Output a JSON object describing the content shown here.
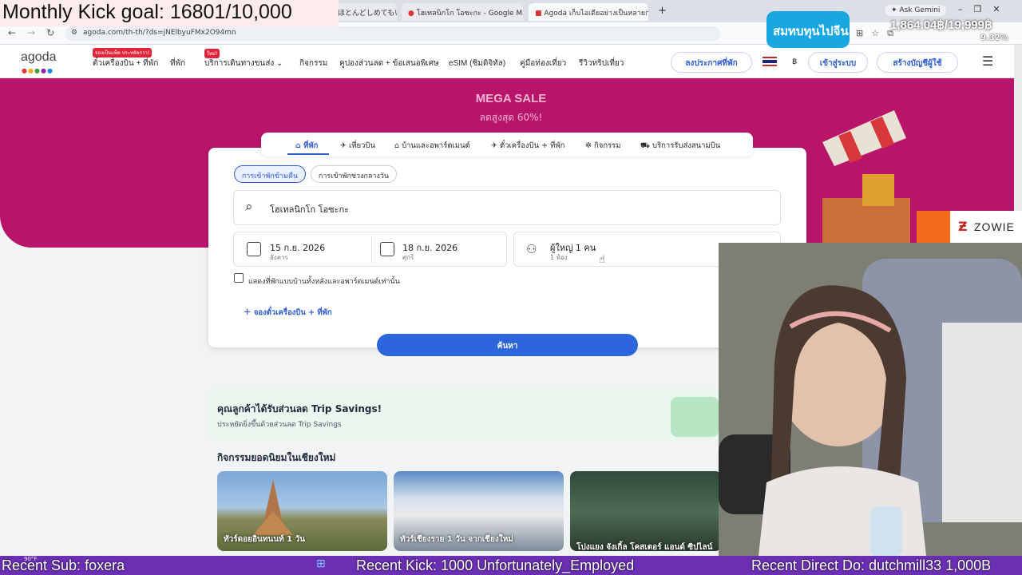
{
  "browser": {
    "tabs": [
      {
        "label": "ほとんどしめてもいい"
      },
      {
        "label": "โฮเทลนิกโก โอซะกะ - Google Maps"
      },
      {
        "label": "Agoda เก็บไอเดียอย่างเป็นหลายการ | ร"
      }
    ],
    "new_tab": "+",
    "ask_gemini": "Ask Gemini",
    "url": "agoda.com/th-th/?ds=jNElbyuFMx2O94mn"
  },
  "header": {
    "logo": "agoda",
    "flight_badge": "จองเป็นแพ็ค ประหยัดกว่า!",
    "nav": [
      "ตั๋วเครื่องบิน + ที่พัก",
      "ที่พัก",
      "บริการเดินทางขนส่ง",
      "กิจกรรม",
      "คูปองส่วนลด + ข้อเสนอพิเศษ",
      "eSIM (ซิมดิจิทัล)",
      "คู่มือท่องเที่ยว",
      "รีวิวทริปเที่ยว"
    ],
    "new_badge": "ใหม่!",
    "list_property": "ลงประกาศที่พัก",
    "currency": "฿",
    "login": "เข้าสู่ระบบ",
    "signup": "สร้างบัญชีผู้ใช้"
  },
  "hero": {
    "title": "MEGA SALE",
    "subtitle": "ลดสูงสุด 60%!"
  },
  "search": {
    "tabs": [
      "ที่พัก",
      "เที่ยวบิน",
      "บ้านและอพาร์ตเมนต์",
      "ตั๋วเครื่องบิน + ที่พัก",
      "กิจกรรม",
      "บริการรับส่งสนามบิน"
    ],
    "stay_types": [
      "การเข้าพักข้ามคืน",
      "การเข้าพักช่วงกลางวัน"
    ],
    "destination": "โฮเทลนิกโก โอซะกะ",
    "checkin_date": "15 ก.ย. 2026",
    "checkin_day": "อังคาร",
    "checkout_date": "18 ก.ย. 2026",
    "checkout_day": "ศุกร์",
    "guests": "ผู้ใหญ่ 1 คน",
    "rooms": "1 ห้อง",
    "homes_only": "แสดงที่พักแบบบ้านทั้งหลังและอพาร์ตเมนต์เท่านั้น",
    "add_flight": "จองตั๋วเครื่องบิน + ที่พัก",
    "button": "ค้นหา"
  },
  "savings": {
    "title": "คุณลูกค้าได้รับส่วนลด Trip Savings!",
    "subtitle": "ประหยัดยิ่งขึ้นด้วยส่วนลด Trip Savings"
  },
  "activities": {
    "heading": "กิจกรรมยอดนิยมในเชียงใหม่",
    "cards": [
      "ทัวร์ดอยอินทนนท์ 1 วัน",
      "ทัวร์เชียงราย 1 วัน จากเชียงใหม่",
      "โปงแยง จังเกิ้ล โคสเตอร์ แอนด์ ซิปไลน์"
    ]
  },
  "overlay": {
    "goal": "Monthly Kick goal: 16801/10,000",
    "promo": "สมทบทุนไปจีน",
    "donation": "1,864.04฿/19,999฿",
    "percent": "9.32%",
    "sponsor": "ZOWIE",
    "ticker": [
      "Recent Sub: foxera",
      "Recent Kick: 1000 Unfortunately_Employed",
      "Recent Direct Do: dutchmill33 1,000B"
    ]
  },
  "taskbar": {
    "weather": "90°F"
  },
  "colors": {
    "brand": "#2d5bd7",
    "hero": "#b8156a",
    "ticker": "#6a2fb2"
  }
}
